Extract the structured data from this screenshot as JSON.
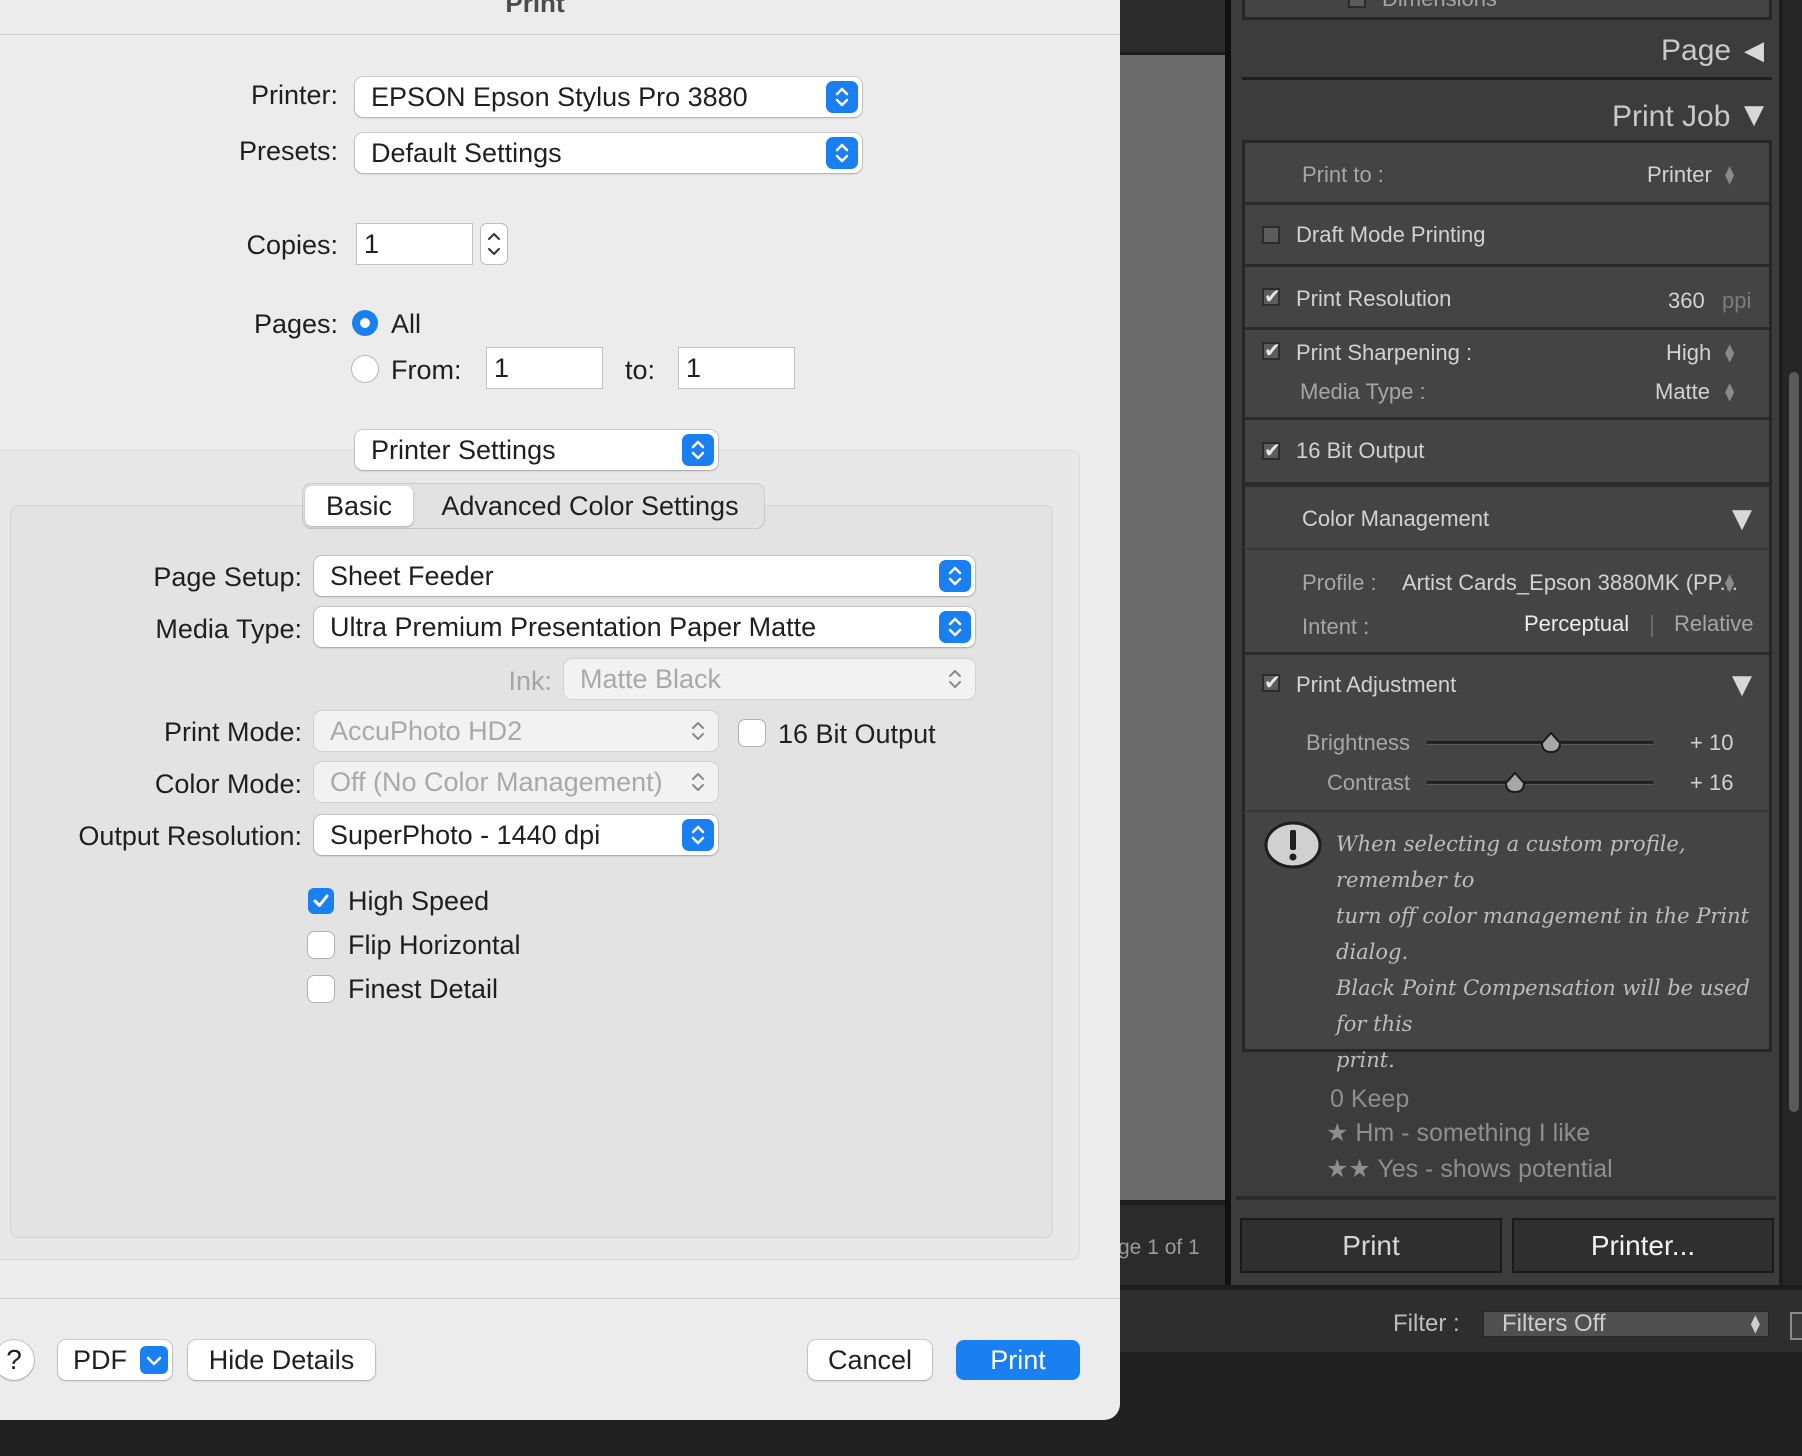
{
  "dialog": {
    "title": "Print",
    "printer": {
      "label": "Printer:",
      "value": "EPSON Epson Stylus Pro 3880"
    },
    "presets": {
      "label": "Presets:",
      "value": "Default Settings"
    },
    "copies": {
      "label": "Copies:",
      "value": "1"
    },
    "pages": {
      "label": "Pages:",
      "all_label": "All",
      "from_label": "From:",
      "from_value": "1",
      "to_label": "to:",
      "to_value": "1",
      "selected": "All"
    },
    "section_popup": "Printer Settings",
    "tabs": [
      {
        "label": "Basic",
        "selected": true
      },
      {
        "label": "Advanced Color Settings",
        "selected": false
      }
    ],
    "page_setup": {
      "label": "Page Setup:",
      "value": "Sheet Feeder"
    },
    "media_type": {
      "label": "Media Type:",
      "value": "Ultra Premium Presentation Paper Matte"
    },
    "ink": {
      "label": "Ink:",
      "value": "Matte Black"
    },
    "print_mode": {
      "label": "Print Mode:",
      "value": "AccuPhoto HD2"
    },
    "bit16": {
      "label": "16 Bit Output",
      "checked": false
    },
    "color_mode": {
      "label": "Color Mode:",
      "value": "Off (No Color Management)"
    },
    "output_resolution": {
      "label": "Output Resolution:",
      "value": "SuperPhoto - 1440 dpi"
    },
    "options": [
      {
        "label": "High Speed",
        "checked": true
      },
      {
        "label": "Flip Horizontal",
        "checked": false
      },
      {
        "label": "Finest Detail",
        "checked": false
      }
    ],
    "footer": {
      "help": "?",
      "pdf": "PDF",
      "hide_details": "Hide Details",
      "cancel": "Cancel",
      "print": "Print"
    },
    "accent_color": "#1a7ff0"
  },
  "lightroom": {
    "partial_top_label": "Dimensions",
    "page_panel": "Page",
    "print_job_panel": "Print Job",
    "print_to": {
      "label": "Print to :",
      "value": "Printer"
    },
    "draft_mode": {
      "label": "Draft Mode Printing",
      "checked": false
    },
    "print_resolution": {
      "label": "Print Resolution",
      "value": "360",
      "unit": "ppi",
      "checked": true
    },
    "print_sharpening": {
      "label": "Print Sharpening :",
      "value": "High",
      "checked": true
    },
    "media_type": {
      "label": "Media Type :",
      "value": "Matte"
    },
    "bit16": {
      "label": "16 Bit Output",
      "checked": true
    },
    "color_management": {
      "label": "Color Management",
      "profile_label": "Profile :",
      "profile_value": "Artist Cards_Epson 3880MK (PP...",
      "intent_label": "Intent :",
      "intent_options": [
        "Perceptual",
        "Relative"
      ],
      "intent_selected": "Perceptual"
    },
    "print_adjustment": {
      "label": "Print Adjustment",
      "checked": true,
      "brightness": {
        "label": "Brightness",
        "value": 10,
        "display": "+ 10"
      },
      "contrast": {
        "label": "Contrast",
        "value": 16,
        "display": "+ 16"
      }
    },
    "warning": {
      "icon": "exclamation-icon",
      "text_lines": [
        "When selecting a custom profile, remember to",
        "turn off color management in the Print dialog.",
        "Black Point Compensation will be used for this",
        "print."
      ]
    },
    "rating_menu": [
      "0 Keep",
      "★ Hm - something I like",
      "★★ Yes - shows potential"
    ],
    "page_count": "ge 1 of 1",
    "print_button": "Print",
    "printer_button": "Printer...",
    "filter": {
      "label": "Filter :",
      "value": "Filters Off"
    }
  }
}
